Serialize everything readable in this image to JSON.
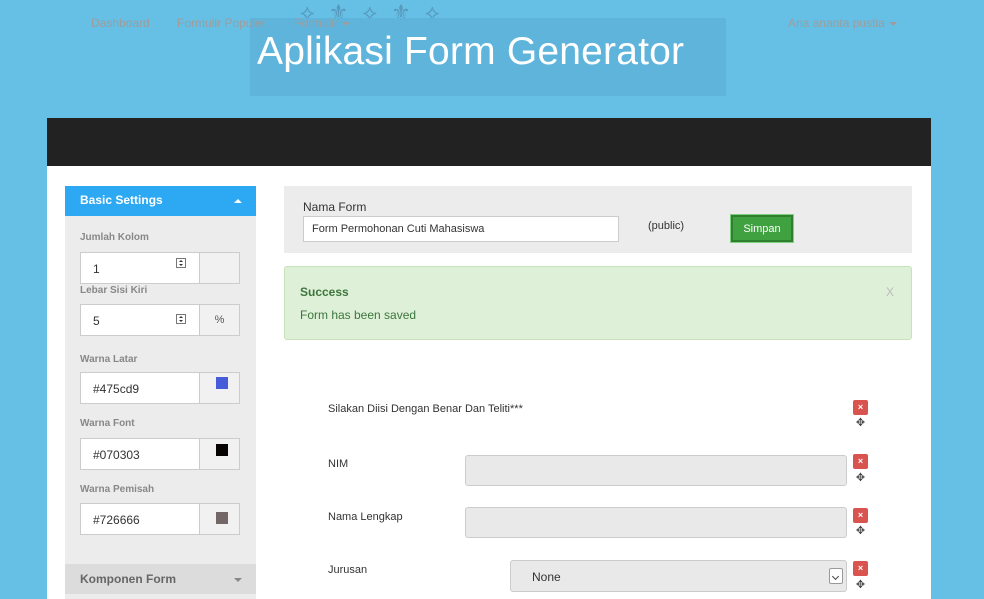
{
  "app": {
    "title": "Aplikasi Form Generator"
  },
  "navbar": {
    "items": [
      {
        "label": "Dashboard"
      },
      {
        "label": "Formulir Populer"
      },
      {
        "label": "Formulir"
      }
    ],
    "user_label": "Ana ananta pustia"
  },
  "sidebar": {
    "basic_settings_label": "Basic Settings",
    "jumlah_kolom": {
      "label": "Jumlah Kolom",
      "value": "1"
    },
    "lebar_sisi_kiri": {
      "label": "Lebar Sisi Kiri",
      "value": "5",
      "unit": "%"
    },
    "warna_latar": {
      "label": "Warna Latar",
      "value": "#475cd9",
      "color": "#475cd9"
    },
    "warna_font": {
      "label": "Warna Font",
      "value": "#070303",
      "color": "#070303"
    },
    "warna_pemisah": {
      "label": "Warna Pemisah",
      "value": "#726666",
      "color": "#726666"
    },
    "komponen_form_label": "Komponen Form"
  },
  "form": {
    "name_label": "Nama Form",
    "name_value": "Form Permohonan Cuti Mahasiswa",
    "visibility": "(public)",
    "save_label": "Simpan"
  },
  "alert": {
    "title": "Success",
    "message": "Form has been saved",
    "close": "X"
  },
  "fields": {
    "intro": "Silakan Diisi Dengan Benar Dan Teliti***",
    "nim_label": "NIM",
    "nama_label": "Nama Lengkap",
    "jurusan_label": "Jurusan",
    "jurusan_value": "None"
  },
  "icons": {
    "delete": "×",
    "move": "✥"
  },
  "colors": {
    "accent": "#2da8f2",
    "success": "#3fa13f",
    "danger": "#d9534f",
    "banner": "#66bfe5",
    "navbar": "#222222"
  }
}
